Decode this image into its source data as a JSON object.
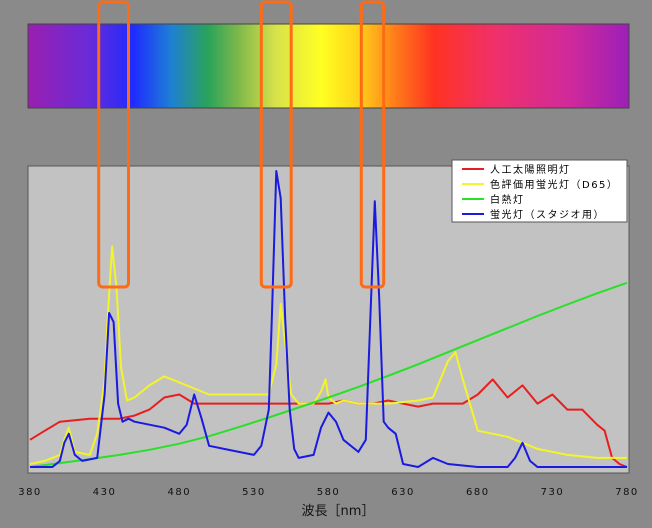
{
  "chart_data": {
    "type": "line",
    "title": "",
    "xlabel": "波長［nm］",
    "ylabel": "",
    "xlim": [
      380,
      780
    ],
    "x_ticks": [
      380,
      430,
      480,
      530,
      580,
      630,
      680,
      730,
      780
    ],
    "grid": false,
    "legend_placement": "top-right",
    "spectrum_bar": {
      "range": [
        380,
        780
      ],
      "stops": [
        {
          "nm": 380,
          "color": "#9a1fb0"
        },
        {
          "nm": 420,
          "color": "#6a2bd8"
        },
        {
          "nm": 450,
          "color": "#1f2bff"
        },
        {
          "nm": 475,
          "color": "#1e7fd6"
        },
        {
          "nm": 500,
          "color": "#2aa35a"
        },
        {
          "nm": 520,
          "color": "#7fb84a"
        },
        {
          "nm": 545,
          "color": "#d8e24a"
        },
        {
          "nm": 575,
          "color": "#ffff22"
        },
        {
          "nm": 600,
          "color": "#ffd21a"
        },
        {
          "nm": 625,
          "color": "#ff7a1a"
        },
        {
          "nm": 650,
          "color": "#ff3322"
        },
        {
          "nm": 690,
          "color": "#f0306a"
        },
        {
          "nm": 740,
          "color": "#d02a9a"
        },
        {
          "nm": 780,
          "color": "#9c1fb8"
        }
      ]
    },
    "highlight_bands": [
      {
        "name": "band-435",
        "x": [
          426,
          446
        ],
        "color": "#ff6a14"
      },
      {
        "name": "band-545",
        "x": [
          535,
          555
        ],
        "color": "#ff6a14"
      },
      {
        "name": "band-611",
        "x": [
          602,
          617
        ],
        "color": "#ff6a14"
      }
    ],
    "series": [
      {
        "name": "人工太陽照明灯",
        "color": "#e81e1e",
        "x": [
          380,
          390,
          400,
          410,
          420,
          430,
          440,
          450,
          460,
          470,
          480,
          490,
          500,
          510,
          520,
          530,
          540,
          550,
          560,
          570,
          580,
          590,
          600,
          610,
          620,
          630,
          640,
          650,
          660,
          670,
          680,
          690,
          700,
          710,
          720,
          730,
          740,
          750,
          760,
          765,
          770,
          775,
          780
        ],
        "y": [
          10,
          13,
          16,
          16.5,
          17,
          17,
          17,
          18,
          20,
          24,
          25,
          22,
          22,
          22,
          22,
          22,
          22,
          22,
          22,
          22,
          22,
          23,
          22,
          22,
          23,
          22,
          21,
          22,
          22,
          22,
          25,
          30,
          24,
          28,
          22,
          25,
          20,
          20,
          15,
          13,
          4,
          2,
          1
        ]
      },
      {
        "name": "色評価用蛍光灯（D65）",
        "color": "#f4f42a",
        "x": [
          380,
          390,
          400,
          403,
          406,
          410,
          420,
          425,
          430,
          432,
          435,
          438,
          441,
          445,
          450,
          460,
          470,
          480,
          490,
          500,
          520,
          540,
          545,
          548,
          551,
          555,
          560,
          570,
          575,
          578,
          580,
          585,
          590,
          600,
          620,
          640,
          650,
          660,
          665,
          670,
          680,
          700,
          720,
          740,
          760,
          770,
          780
        ],
        "y": [
          2,
          3,
          5,
          10,
          14,
          6,
          5,
          12,
          30,
          50,
          74,
          60,
          34,
          23,
          24,
          28,
          31,
          29,
          27,
          25,
          25,
          25,
          35,
          55,
          42,
          25,
          22,
          22,
          26,
          30,
          24,
          22,
          23,
          22,
          22,
          23,
          24,
          36,
          39,
          30,
          13,
          11,
          7,
          5,
          4,
          4,
          4
        ]
      },
      {
        "name": "白熱灯",
        "color": "#28e028",
        "x": [
          380,
          400,
          420,
          440,
          460,
          480,
          500,
          520,
          540,
          560,
          580,
          600,
          620,
          640,
          660,
          680,
          700,
          720,
          740,
          760,
          780
        ],
        "y": [
          1,
          2.3,
          3.6,
          5,
          6.7,
          8.7,
          11.2,
          14.2,
          17.4,
          20.7,
          24,
          27.5,
          31.2,
          35,
          39,
          43,
          47,
          51,
          54.8,
          58.5,
          62
        ]
      },
      {
        "name": "蛍光灯（スタジオ用）",
        "color": "#1a1ae0",
        "x": [
          380,
          395,
          400,
          403,
          406,
          410,
          415,
          425,
          430,
          433,
          436,
          439,
          442,
          446,
          450,
          460,
          470,
          480,
          485,
          490,
          495,
          500,
          510,
          520,
          530,
          535,
          540,
          542,
          545,
          548,
          551,
          554,
          557,
          560,
          570,
          575,
          580,
          585,
          590,
          600,
          605,
          608,
          611,
          614,
          617,
          620,
          625,
          630,
          640,
          650,
          660,
          680,
          700,
          705,
          710,
          715,
          720,
          740,
          760,
          780
        ],
        "y": [
          1,
          1,
          3,
          9,
          12,
          5,
          3,
          4,
          25,
          52,
          49,
          22,
          16,
          17,
          16,
          15,
          14,
          12,
          15,
          25,
          17,
          8,
          7,
          6,
          5,
          8,
          20,
          50,
          99,
          90,
          50,
          20,
          7,
          4,
          5,
          14,
          19,
          16,
          10,
          6,
          10,
          50,
          89,
          57,
          16,
          14,
          12,
          2,
          1,
          4,
          2,
          1,
          1,
          4,
          9,
          3,
          1,
          1,
          1,
          1
        ]
      }
    ]
  }
}
